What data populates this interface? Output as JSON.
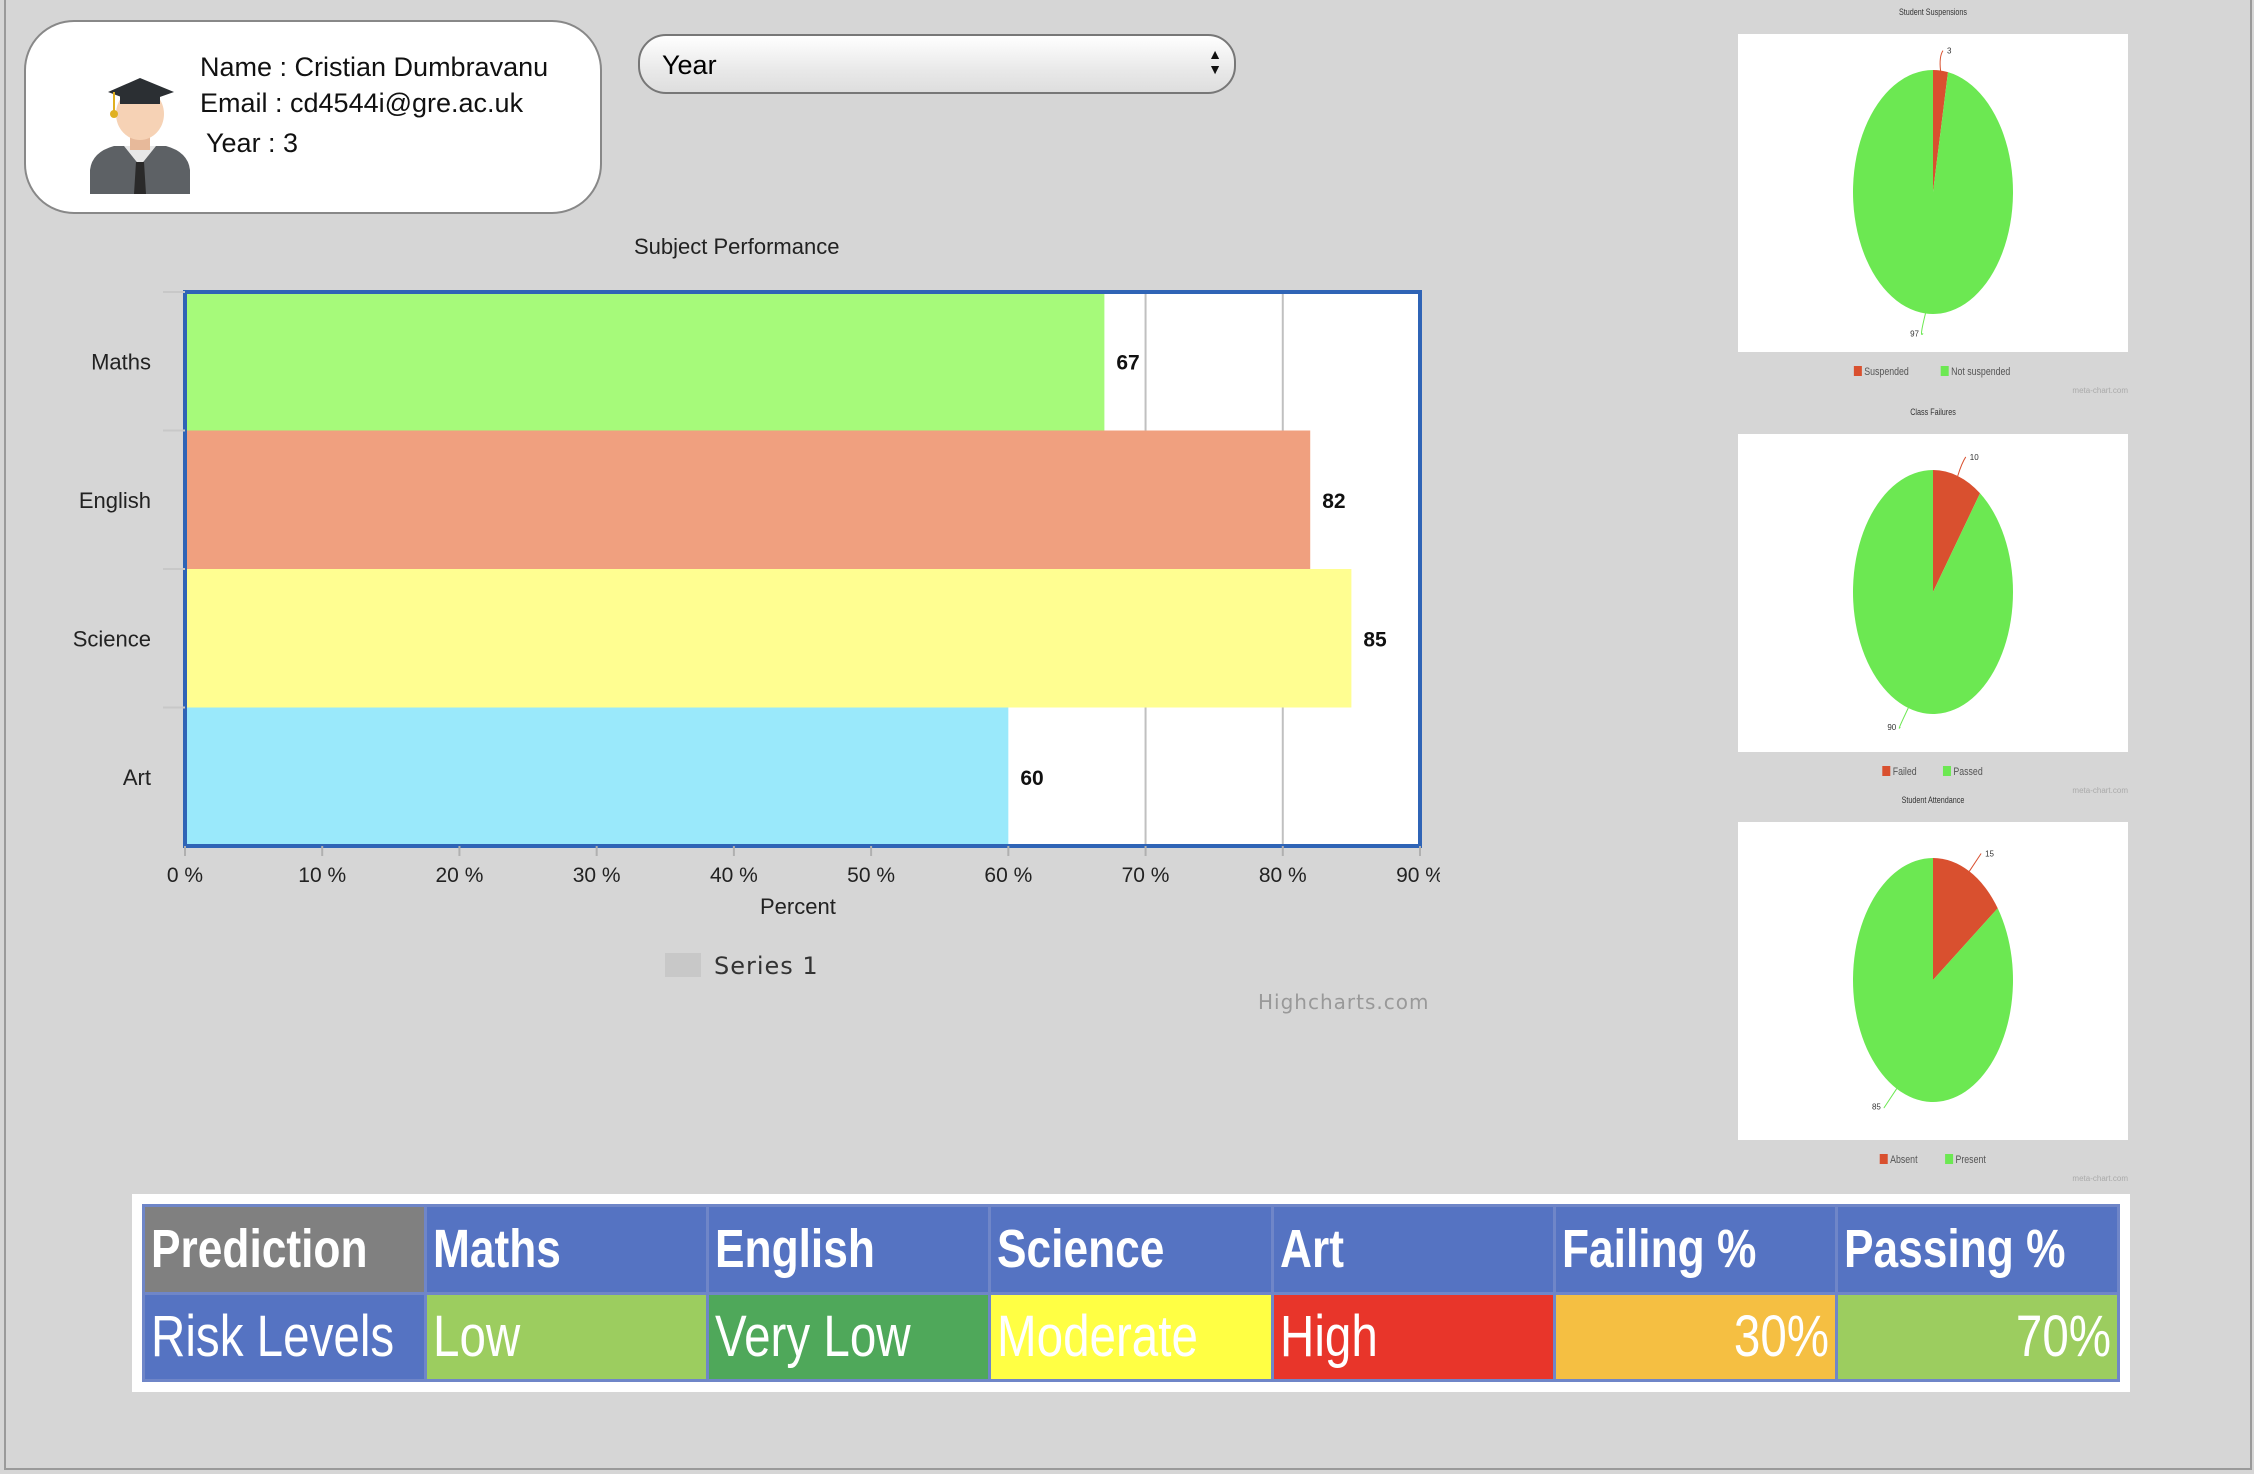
{
  "profile": {
    "name_line": "Name : Cristian Dumbravanu",
    "email_line": "Email : cd4544i@gre.ac.uk",
    "year_line": "Year : 3"
  },
  "year_select": {
    "selected": "Year"
  },
  "chart_data": [
    {
      "type": "bar",
      "orientation": "horizontal",
      "title": "Subject Performance",
      "categories": [
        "Maths",
        "English",
        "Science",
        "Art"
      ],
      "values": [
        67,
        82,
        85,
        60
      ],
      "colors": [
        "#a6fa7a",
        "#f0a07f",
        "#fffe91",
        "#9ae9fb"
      ],
      "xlabel": "Percent",
      "ylabel": "",
      "xlim": [
        0,
        90
      ],
      "x_ticks": [
        "0 %",
        "10 %",
        "20 %",
        "30 %",
        "40 %",
        "50 %",
        "60 %",
        "70 %",
        "80 %",
        "90 %"
      ],
      "series": [
        {
          "name": "Series 1",
          "values": [
            67,
            82,
            85,
            60
          ]
        }
      ],
      "legend": "bottom-center",
      "grid": true,
      "credit": "Highcharts.com"
    },
    {
      "type": "pie",
      "title": "Student Suspensions",
      "slices": [
        {
          "label": "Suspended",
          "value": 3,
          "color": "#d9502f"
        },
        {
          "label": "Not suspended",
          "value": 97,
          "color": "#6ce852"
        }
      ],
      "legend": "bottom-center",
      "credit": "meta-chart.com"
    },
    {
      "type": "pie",
      "title": "Class Failures",
      "slices": [
        {
          "label": "Failed",
          "value": 10,
          "color": "#d9502f"
        },
        {
          "label": "Passed",
          "value": 90,
          "color": "#6ce852"
        }
      ],
      "legend": "bottom-center",
      "credit": "meta-chart.com"
    },
    {
      "type": "pie",
      "title": "Student Attendance",
      "slices": [
        {
          "label": "Absent",
          "value": 15,
          "color": "#d9502f"
        },
        {
          "label": "Present",
          "value": 85,
          "color": "#6ce852"
        }
      ],
      "legend": "bottom-center",
      "credit": "meta-chart.com"
    }
  ],
  "prediction_table": {
    "headers": [
      "Prediction",
      "Maths",
      "English",
      "Science",
      "Art",
      "Failing %",
      "Passing %"
    ],
    "row": [
      "Risk Levels",
      "Low",
      "Very Low",
      "Moderate",
      "High",
      "30%",
      "70%"
    ],
    "row_colors": [
      "#5573c2",
      "#9ccd5f",
      "#4fa85a",
      "#ffff44",
      "#e8352a",
      "#f5bf42",
      "#9ccd5f"
    ]
  }
}
